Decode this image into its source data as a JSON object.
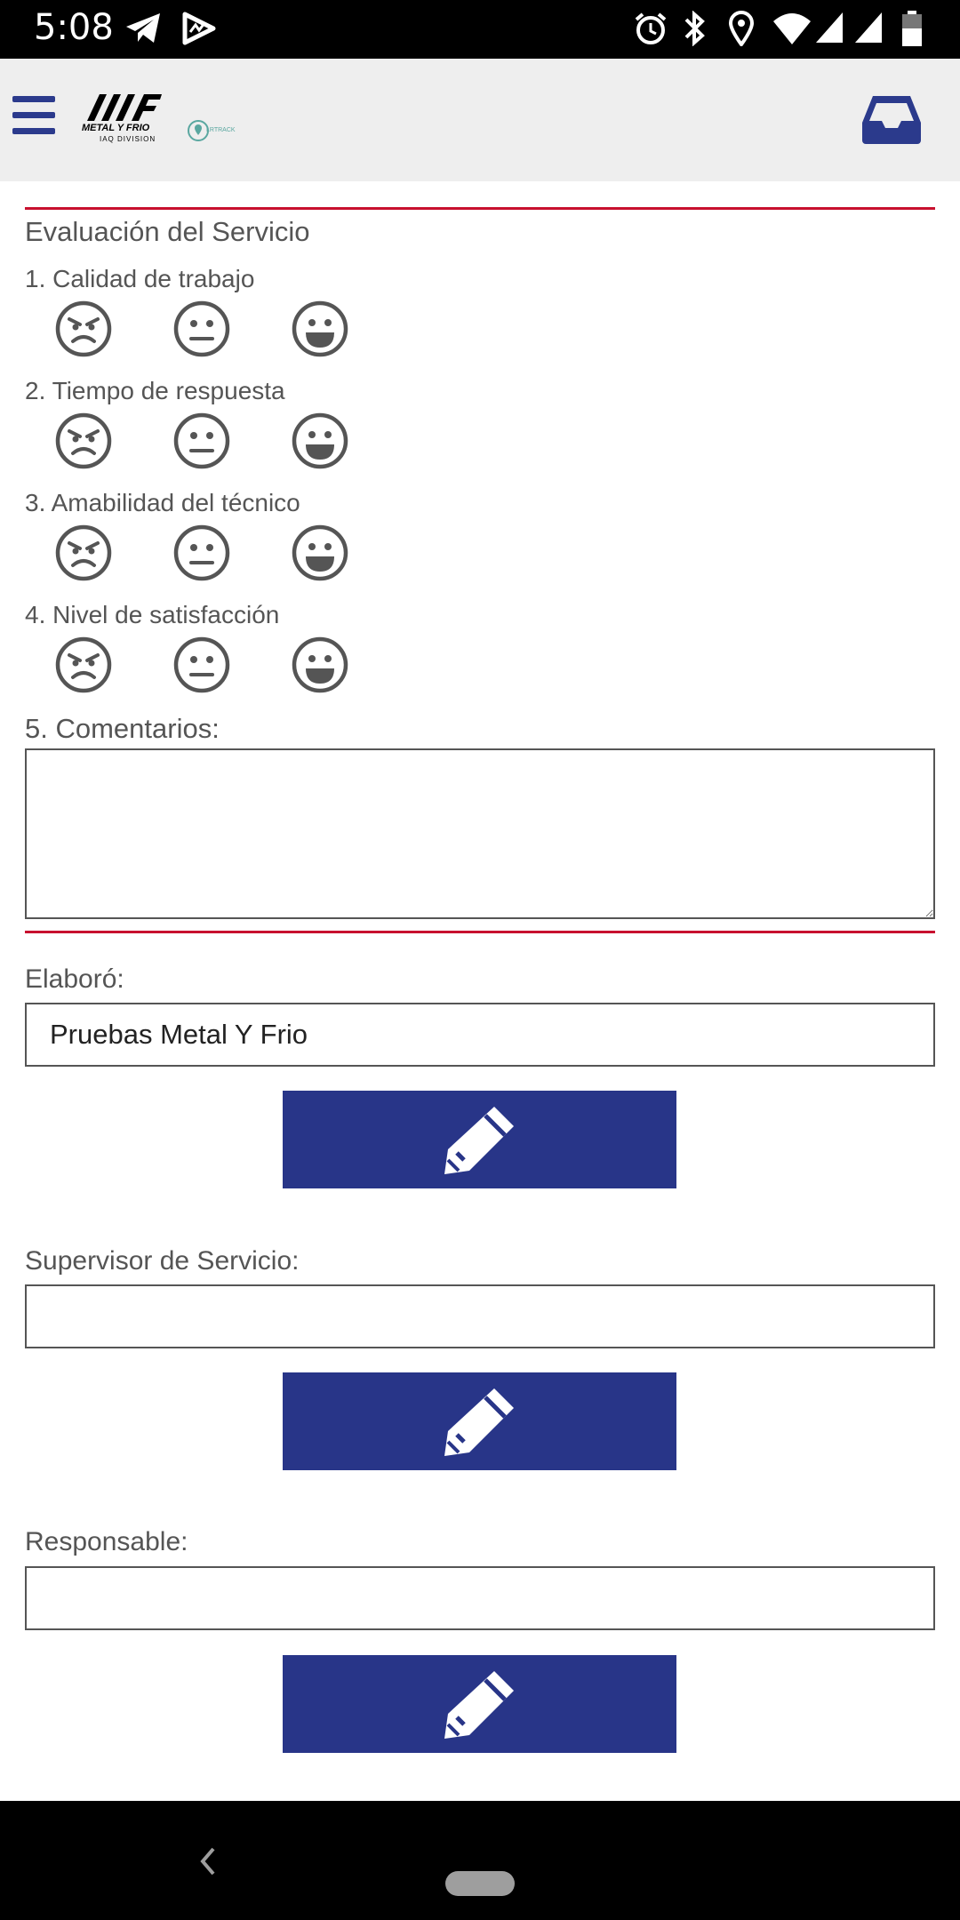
{
  "status_bar": {
    "time": "5:08",
    "icons": [
      "telegram-icon",
      "activity-icon",
      "alarm-icon",
      "bluetooth-icon",
      "location-icon",
      "wifi-icon",
      "signal-icon",
      "signal-icon",
      "battery-icon"
    ]
  },
  "app_bar": {
    "logo_brand": "METAL Y FRIO",
    "logo_sub": "IAQ DIVISION",
    "logo_partner": "LRTRACK",
    "accent_color": "#2b3a8c"
  },
  "evaluation": {
    "title": "Evaluación del Servicio",
    "questions": [
      {
        "label": "1. Calidad de trabajo"
      },
      {
        "label": "2. Tiempo de respuesta"
      },
      {
        "label": "3. Amabilidad del técnico"
      },
      {
        "label": "4. Nivel de satisfacción"
      }
    ],
    "faces": [
      "angry-face-icon",
      "neutral-face-icon",
      "happy-face-icon"
    ],
    "comments_label": "5. Comentarios:",
    "comments_value": ""
  },
  "signatures": [
    {
      "label": "Elaboró:",
      "value": "Pruebas Metal Y Frio"
    },
    {
      "label": "Supervisor de Servicio:",
      "value": ""
    },
    {
      "label": "Responsable:",
      "value": ""
    }
  ],
  "colors": {
    "divider": "#c8102e",
    "button": "#283588"
  }
}
